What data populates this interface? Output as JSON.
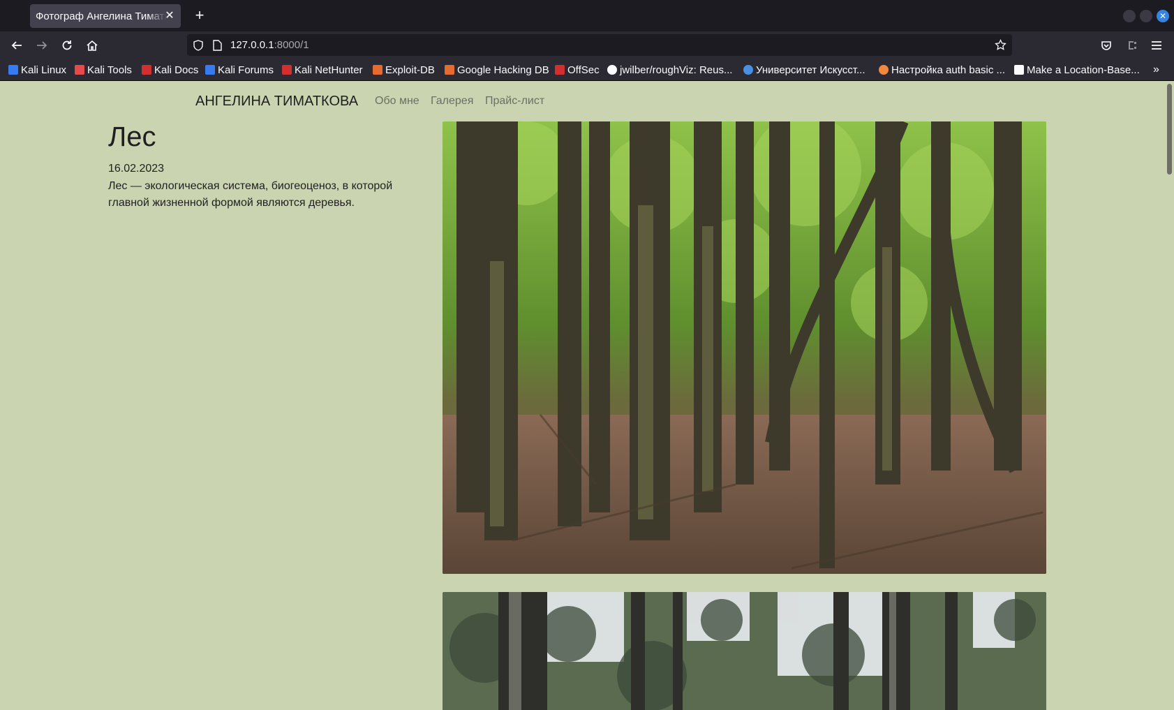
{
  "browser": {
    "tab_title": "Фотограф Ангелина Тиматкова",
    "url_host": "127.0.0.1",
    "url_path": ":8000/1"
  },
  "bookmarks": [
    {
      "label": "Kali Linux",
      "color": "#367bf0"
    },
    {
      "label": "Kali Tools",
      "color": "#e54b4b"
    },
    {
      "label": "Kali Docs",
      "color": "#d32f2f"
    },
    {
      "label": "Kali Forums",
      "color": "#367bf0"
    },
    {
      "label": "Kali NetHunter",
      "color": "#d32f2f"
    },
    {
      "label": "Exploit-DB",
      "color": "#e66b2f"
    },
    {
      "label": "Google Hacking DB",
      "color": "#e66b2f"
    },
    {
      "label": "OffSec",
      "color": "#d32f2f"
    },
    {
      "label": "jwilber/roughViz: Reus...",
      "color": "#fbfbfe"
    },
    {
      "label": "Университет Искусст...",
      "color": "#4a90e2"
    },
    {
      "label": "Настройка auth basic ...",
      "color": "#f0883e"
    },
    {
      "label": "Make a Location-Base...",
      "color": "#fbfbfe"
    }
  ],
  "site": {
    "brand": "АНГЕЛИНА ТИМАТКОВА",
    "nav": [
      "Обо мне",
      "Галерея",
      "Прайс-лист"
    ]
  },
  "post": {
    "title": "Лес",
    "date": "16.02.2023",
    "description": "Лес — экологическая система, биогеоценоз, в которой главной жизненной формой являются деревья."
  },
  "colors": {
    "page_bg": "#cad4b1",
    "nav_link": "#6b6f63",
    "text": "#1f1f1f"
  }
}
